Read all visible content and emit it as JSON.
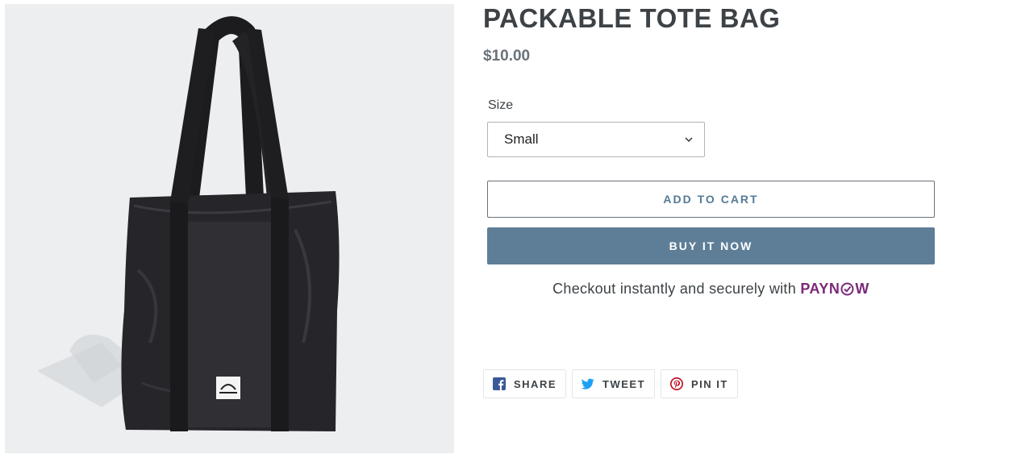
{
  "product": {
    "title": "PACKABLE TOTE BAG",
    "price": "$10.00",
    "image_alt": "black tote bag",
    "logo_text": "adidas"
  },
  "variant": {
    "label": "Size",
    "selected": "Small"
  },
  "actions": {
    "add_to_cart": "ADD TO CART",
    "buy_now": "BUY IT NOW"
  },
  "checkout": {
    "text": "Checkout instantly and securely with",
    "brand_before": "PAYN",
    "brand_after": "W"
  },
  "share": {
    "facebook": "SHARE",
    "twitter": "TWEET",
    "pinterest": "PIN IT"
  },
  "colors": {
    "buy_button": "#5e7e98",
    "add_to_cart_text": "#557b97",
    "paynow_brand": "#7a2a7a",
    "facebook": "#3b5998",
    "twitter": "#1da1f2",
    "pinterest": "#bd081c"
  },
  "icons": {
    "dropdown": "chevron-down-icon",
    "facebook": "facebook-icon",
    "twitter": "twitter-icon",
    "pinterest": "pinterest-icon"
  }
}
